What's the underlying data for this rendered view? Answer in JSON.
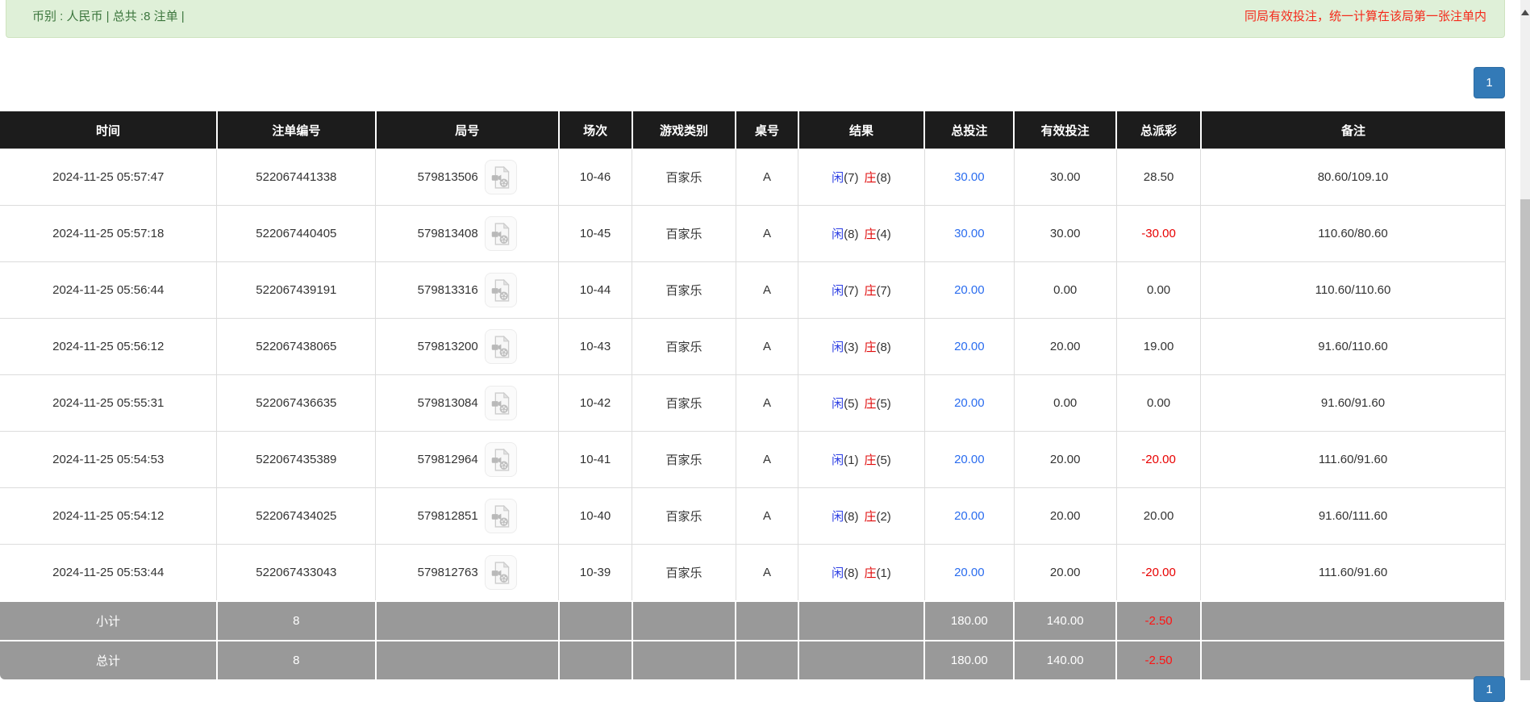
{
  "top_bar": {
    "summary": "币别 : 人民币 | 总共 :8 注单 |",
    "notice": "同局有效投注，统一计算在该局第一张注单内"
  },
  "pagination": {
    "page": "1"
  },
  "colors": {
    "accent_blue": "#337ab7",
    "player_blue": "#2d3fe3",
    "banker_red": "#e00b0b",
    "negative_red": "#e80000",
    "notice_red": "#f5291a",
    "header_bg": "#1c1c1c",
    "footer_bg": "#999999",
    "alert_bg": "#dff0d8"
  },
  "icons": {
    "video_replay": "video-file-icon",
    "scroll_up": "scroll-up-arrow-icon"
  },
  "table": {
    "headers": [
      "时间",
      "注单编号",
      "局号",
      "场次",
      "游戏类别",
      "桌号",
      "结果",
      "总投注",
      "有效投注",
      "总派彩",
      "备注"
    ],
    "rows": [
      {
        "time": "2024-11-25 05:57:47",
        "bet_id": "522067441338",
        "round_id": "579813506",
        "session": "10-46",
        "game": "百家乐",
        "table_no": "A",
        "player": "闲",
        "player_pts": "(7)",
        "banker": "庄",
        "banker_pts": "(8)",
        "total_bet": "30.00",
        "valid_bet": "30.00",
        "payout": "28.50",
        "remark": "80.60/109.10"
      },
      {
        "time": "2024-11-25 05:57:18",
        "bet_id": "522067440405",
        "round_id": "579813408",
        "session": "10-45",
        "game": "百家乐",
        "table_no": "A",
        "player": "闲",
        "player_pts": "(8)",
        "banker": "庄",
        "banker_pts": "(4)",
        "total_bet": "30.00",
        "valid_bet": "30.00",
        "payout": "-30.00",
        "remark": "110.60/80.60"
      },
      {
        "time": "2024-11-25 05:56:44",
        "bet_id": "522067439191",
        "round_id": "579813316",
        "session": "10-44",
        "game": "百家乐",
        "table_no": "A",
        "player": "闲",
        "player_pts": "(7)",
        "banker": "庄",
        "banker_pts": "(7)",
        "total_bet": "20.00",
        "valid_bet": "0.00",
        "payout": "0.00",
        "remark": "110.60/110.60"
      },
      {
        "time": "2024-11-25 05:56:12",
        "bet_id": "522067438065",
        "round_id": "579813200",
        "session": "10-43",
        "game": "百家乐",
        "table_no": "A",
        "player": "闲",
        "player_pts": "(3)",
        "banker": "庄",
        "banker_pts": "(8)",
        "total_bet": "20.00",
        "valid_bet": "20.00",
        "payout": "19.00",
        "remark": "91.60/110.60"
      },
      {
        "time": "2024-11-25 05:55:31",
        "bet_id": "522067436635",
        "round_id": "579813084",
        "session": "10-42",
        "game": "百家乐",
        "table_no": "A",
        "player": "闲",
        "player_pts": "(5)",
        "banker": "庄",
        "banker_pts": "(5)",
        "total_bet": "20.00",
        "valid_bet": "0.00",
        "payout": "0.00",
        "remark": "91.60/91.60"
      },
      {
        "time": "2024-11-25 05:54:53",
        "bet_id": "522067435389",
        "round_id": "579812964",
        "session": "10-41",
        "game": "百家乐",
        "table_no": "A",
        "player": "闲",
        "player_pts": "(1)",
        "banker": "庄",
        "banker_pts": "(5)",
        "total_bet": "20.00",
        "valid_bet": "20.00",
        "payout": "-20.00",
        "remark": "111.60/91.60"
      },
      {
        "time": "2024-11-25 05:54:12",
        "bet_id": "522067434025",
        "round_id": "579812851",
        "session": "10-40",
        "game": "百家乐",
        "table_no": "A",
        "player": "闲",
        "player_pts": "(8)",
        "banker": "庄",
        "banker_pts": "(2)",
        "total_bet": "20.00",
        "valid_bet": "20.00",
        "payout": "20.00",
        "remark": "91.60/111.60"
      },
      {
        "time": "2024-11-25 05:53:44",
        "bet_id": "522067433043",
        "round_id": "579812763",
        "session": "10-39",
        "game": "百家乐",
        "table_no": "A",
        "player": "闲",
        "player_pts": "(8)",
        "banker": "庄",
        "banker_pts": "(1)",
        "total_bet": "20.00",
        "valid_bet": "20.00",
        "payout": "-20.00",
        "remark": "111.60/91.60"
      }
    ],
    "footer": [
      {
        "label": "小计",
        "count": "8",
        "total_bet": "180.00",
        "valid_bet": "140.00",
        "payout": "-2.50"
      },
      {
        "label": "总计",
        "count": "8",
        "total_bet": "180.00",
        "valid_bet": "140.00",
        "payout": "-2.50"
      }
    ]
  }
}
